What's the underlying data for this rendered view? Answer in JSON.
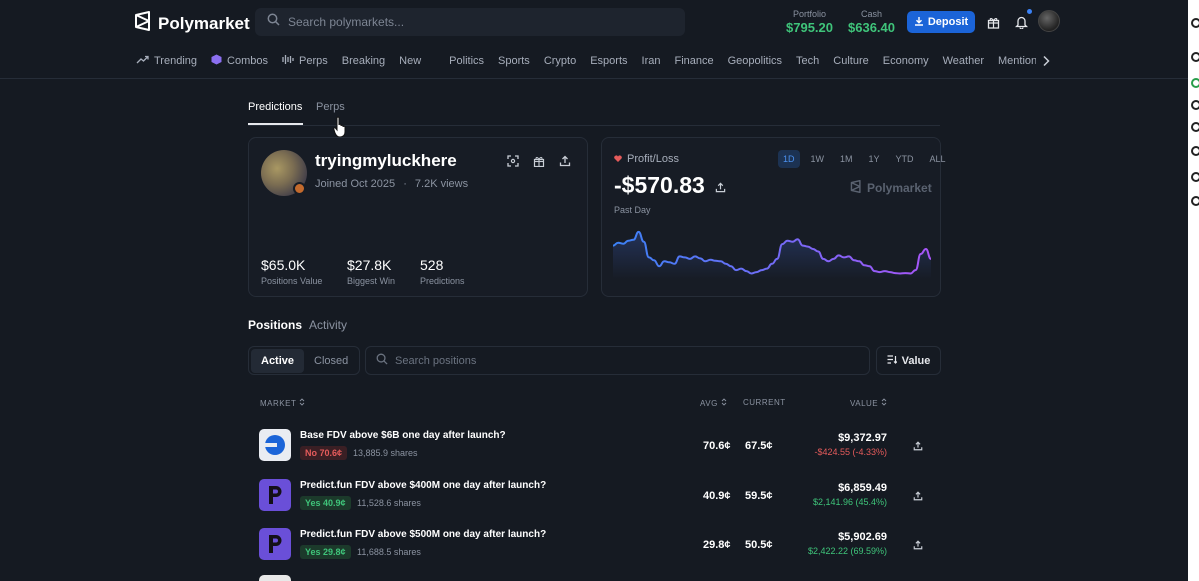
{
  "header": {
    "brand": "Polymarket",
    "search_placeholder": "Search polymarkets...",
    "portfolio_label": "Portfolio",
    "portfolio_value": "$795.20",
    "cash_label": "Cash",
    "cash_value": "$636.40",
    "deposit_label": "Deposit"
  },
  "categories": [
    "Trending",
    "Combos",
    "Perps",
    "Breaking",
    "New",
    "Politics",
    "Sports",
    "Crypto",
    "Esports",
    "Iran",
    "Finance",
    "Geopolitics",
    "Tech",
    "Culture",
    "Economy",
    "Weather",
    "Mentions"
  ],
  "page_tabs": {
    "predictions": "Predictions",
    "perps": "Perps"
  },
  "profile": {
    "username": "tryingmyluckhere",
    "joined": "Joined Oct 2025",
    "separator": "·",
    "views": "7.2K views",
    "stats": [
      {
        "value": "$65.0K",
        "label": "Positions Value"
      },
      {
        "value": "$27.8K",
        "label": "Biggest Win"
      },
      {
        "value": "528",
        "label": "Predictions"
      }
    ]
  },
  "pnl": {
    "label": "Profit/Loss",
    "ranges": [
      "1D",
      "1W",
      "1M",
      "1Y",
      "YTD",
      "ALL"
    ],
    "active_range": "1D",
    "value": "-$570.83",
    "brand": "Polymarket",
    "period": "Past Day",
    "series": [
      0.62,
      0.68,
      0.66,
      0.72,
      0.74,
      0.9,
      0.7,
      0.38,
      0.32,
      0.2,
      0.3,
      0.28,
      0.25,
      0.4,
      0.38,
      0.35,
      0.4,
      0.36,
      0.3,
      0.33,
      0.31,
      0.3,
      0.25,
      0.2,
      0.12,
      0.15,
      0.1,
      0.05,
      0.08,
      0.12,
      0.15,
      0.25,
      0.35,
      0.65,
      0.72,
      0.7,
      0.75,
      0.62,
      0.6,
      0.55,
      0.5,
      0.35,
      0.3,
      0.35,
      0.42,
      0.38,
      0.4,
      0.32,
      0.3,
      0.22,
      0.2,
      0.1,
      0.08,
      0.1,
      0.08,
      0.06,
      0.05,
      0.06,
      0.05,
      0.12,
      0.45,
      0.55,
      0.35
    ],
    "line_color_start": "#3b82f6",
    "line_color_end": "#a855f7"
  },
  "positions": {
    "tab_positions": "Positions",
    "tab_activity": "Activity",
    "filter_active": "Active",
    "filter_closed": "Closed",
    "search_placeholder": "Search positions",
    "sort_label": "Value",
    "headers": {
      "market": "MARKET",
      "avg": "AVG",
      "current": "CURRENT",
      "value": "VALUE"
    },
    "rows": [
      {
        "title": "Base FDV above $6B one day after launch?",
        "side": "No 70.6¢",
        "side_kind": "no",
        "shares": "13,885.9 shares",
        "avg": "70.6¢",
        "current": "67.5¢",
        "value": "$9,372.97",
        "change": "-$424.55 (-4.33%)",
        "change_kind": "neg",
        "icon": "base-logo-icon"
      },
      {
        "title": "Predict.fun FDV above $400M one day after launch?",
        "side": "Yes 40.9¢",
        "side_kind": "yes",
        "shares": "11,528.6 shares",
        "avg": "40.9¢",
        "current": "59.5¢",
        "value": "$6,859.49",
        "change": "$2,141.96 (45.4%)",
        "change_kind": "pos",
        "icon": "predictfun-logo-icon"
      },
      {
        "title": "Predict.fun FDV above $500M one day after launch?",
        "side": "Yes 29.8¢",
        "side_kind": "yes",
        "shares": "11,688.5 shares",
        "avg": "29.8¢",
        "current": "50.5¢",
        "value": "$5,902.69",
        "change": "$2,422.22 (69.59%)",
        "change_kind": "pos",
        "icon": "predictfun-logo-icon"
      }
    ]
  },
  "colors": {
    "accent": "#1b64d8",
    "positive": "#3fc47a",
    "negative": "#e55b5b",
    "background": "#151a22"
  }
}
